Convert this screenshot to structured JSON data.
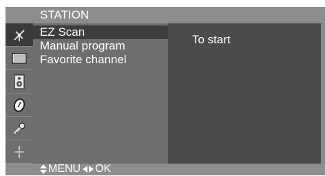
{
  "header": {
    "title": "STATION"
  },
  "sidebar": {
    "icons": [
      {
        "name": "station-antenna-icon",
        "active": true
      },
      {
        "name": "picture-screen-icon",
        "active": false
      },
      {
        "name": "sound-speaker-icon",
        "active": false
      },
      {
        "name": "time-clock-icon",
        "active": false
      },
      {
        "name": "special-key-icon",
        "active": false
      },
      {
        "name": "screen-adjust-icon",
        "active": false
      }
    ]
  },
  "menu": {
    "items": [
      {
        "label": "EZ Scan",
        "selected": true
      },
      {
        "label": "Manual program",
        "selected": false
      },
      {
        "label": "Favorite channel",
        "selected": false
      }
    ]
  },
  "info": {
    "text": "To start"
  },
  "footer": {
    "menu_label": "MENU",
    "ok_label": "OK"
  },
  "colors": {
    "osd_background": "#4b4b4b",
    "header_bar": "#8d8d8d",
    "column_background": "#6e6e6e",
    "selected_row": "#3d3d3d",
    "text": "#ffffff"
  }
}
